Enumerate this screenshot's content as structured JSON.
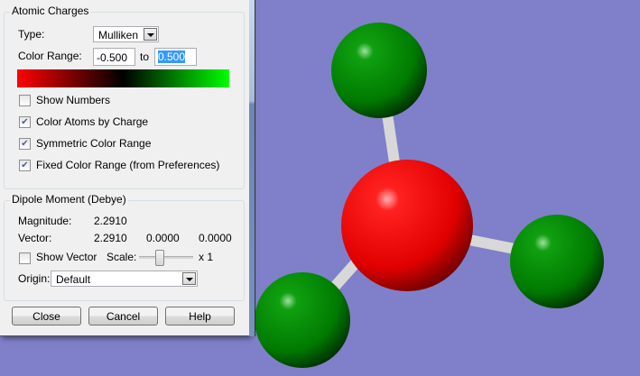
{
  "atomic_charges": {
    "title": "Atomic Charges",
    "type_label": "Type:",
    "type_value": "Mulliken",
    "color_range_label": "Color Range:",
    "range_min": "-0.500",
    "to_label": "to",
    "range_max": "0.500",
    "checkboxes": [
      {
        "label": "Show Numbers",
        "checked": false
      },
      {
        "label": "Color Atoms by Charge",
        "checked": true
      },
      {
        "label": "Symmetric Color Range",
        "checked": true
      },
      {
        "label": "Fixed Color Range (from Preferences)",
        "checked": true
      }
    ]
  },
  "dipole": {
    "title": "Dipole Moment (Debye)",
    "magnitude_label": "Magnitude:",
    "magnitude": "2.2910",
    "vector_label": "Vector:",
    "vector": [
      "2.2910",
      "0.0000",
      "0.0000"
    ],
    "show_vector_label": "Show Vector",
    "show_vector_checked": false,
    "scale_label": "Scale:",
    "scale_value": "x 1",
    "origin_label": "Origin:",
    "origin_value": "Default"
  },
  "buttons": {
    "close": "Close",
    "cancel": "Cancel",
    "help": "Help"
  },
  "colors": {
    "background": "#7f80c9",
    "negative": "#ff0000",
    "positive": "#00ff00",
    "oxygen": "#ff0000",
    "hydrogen": "#00a000"
  }
}
